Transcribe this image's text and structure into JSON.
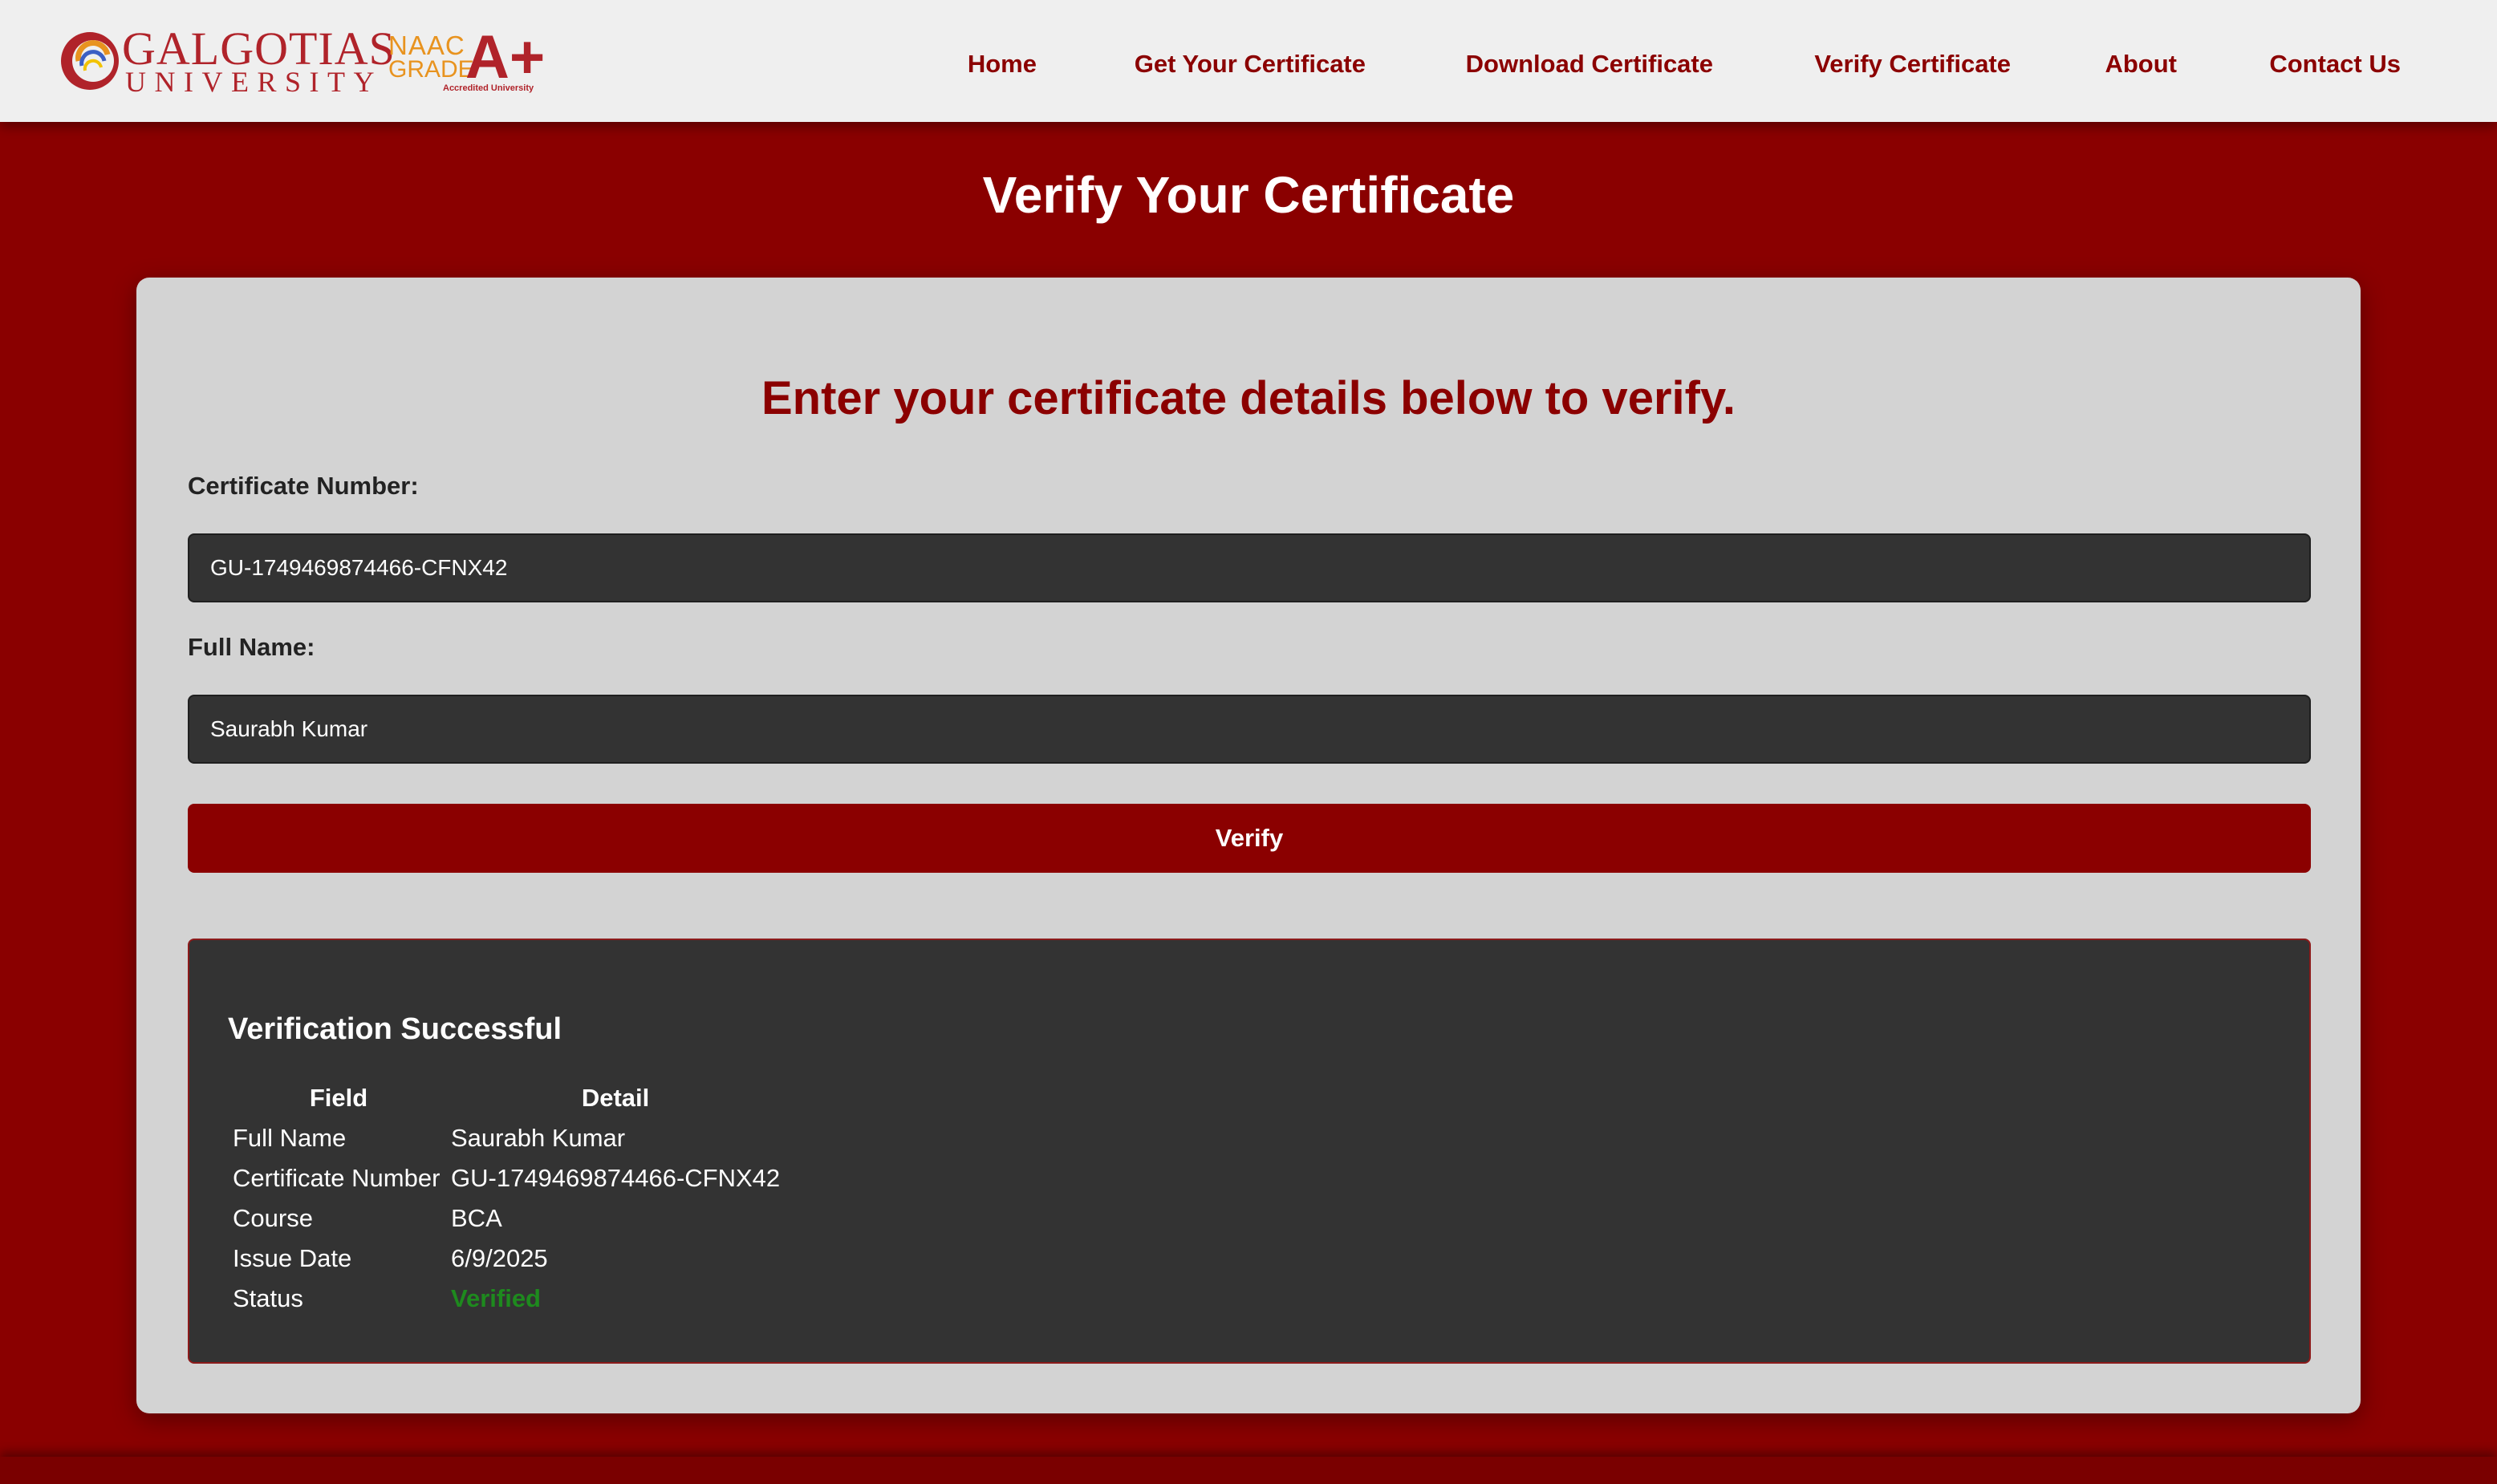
{
  "header": {
    "logo": {
      "university_line1": "GALGOTIAS",
      "university_line2": "UNIVERSITY",
      "naac_line1": "NAAC",
      "naac_line2": "GRADE",
      "naac_grade": "A+",
      "naac_caption": "Accredited University"
    },
    "nav": [
      {
        "label": "Home"
      },
      {
        "label": "Get Your Certificate"
      },
      {
        "label": "Download Certificate"
      },
      {
        "label": "Verify Certificate"
      },
      {
        "label": "About"
      },
      {
        "label": "Contact Us"
      }
    ]
  },
  "main": {
    "page_title": "Verify Your Certificate",
    "card_heading": "Enter your certificate details below to verify.",
    "form": {
      "certificate_number_label": "Certificate Number:",
      "certificate_number_value": "GU-1749469874466-CFNX42",
      "full_name_label": "Full Name:",
      "full_name_value": "Saurabh Kumar",
      "verify_label": "Verify"
    },
    "result": {
      "title": "Verification Successful",
      "headers": [
        "Field",
        "Detail"
      ],
      "rows": [
        {
          "field": "Full Name",
          "detail": "Saurabh Kumar"
        },
        {
          "field": "Certificate Number",
          "detail": "GU-1749469874466-CFNX42"
        },
        {
          "field": "Course",
          "detail": "BCA"
        },
        {
          "field": "Issue Date",
          "detail": "6/9/2025"
        },
        {
          "field": "Status",
          "detail": "Verified"
        }
      ]
    }
  },
  "colors": {
    "brand_red": "#8b0000",
    "card_bg": "#d3d3d3",
    "input_bg": "#333333",
    "verified_green": "#1e8a1e",
    "logo_orange": "#e8931f"
  }
}
